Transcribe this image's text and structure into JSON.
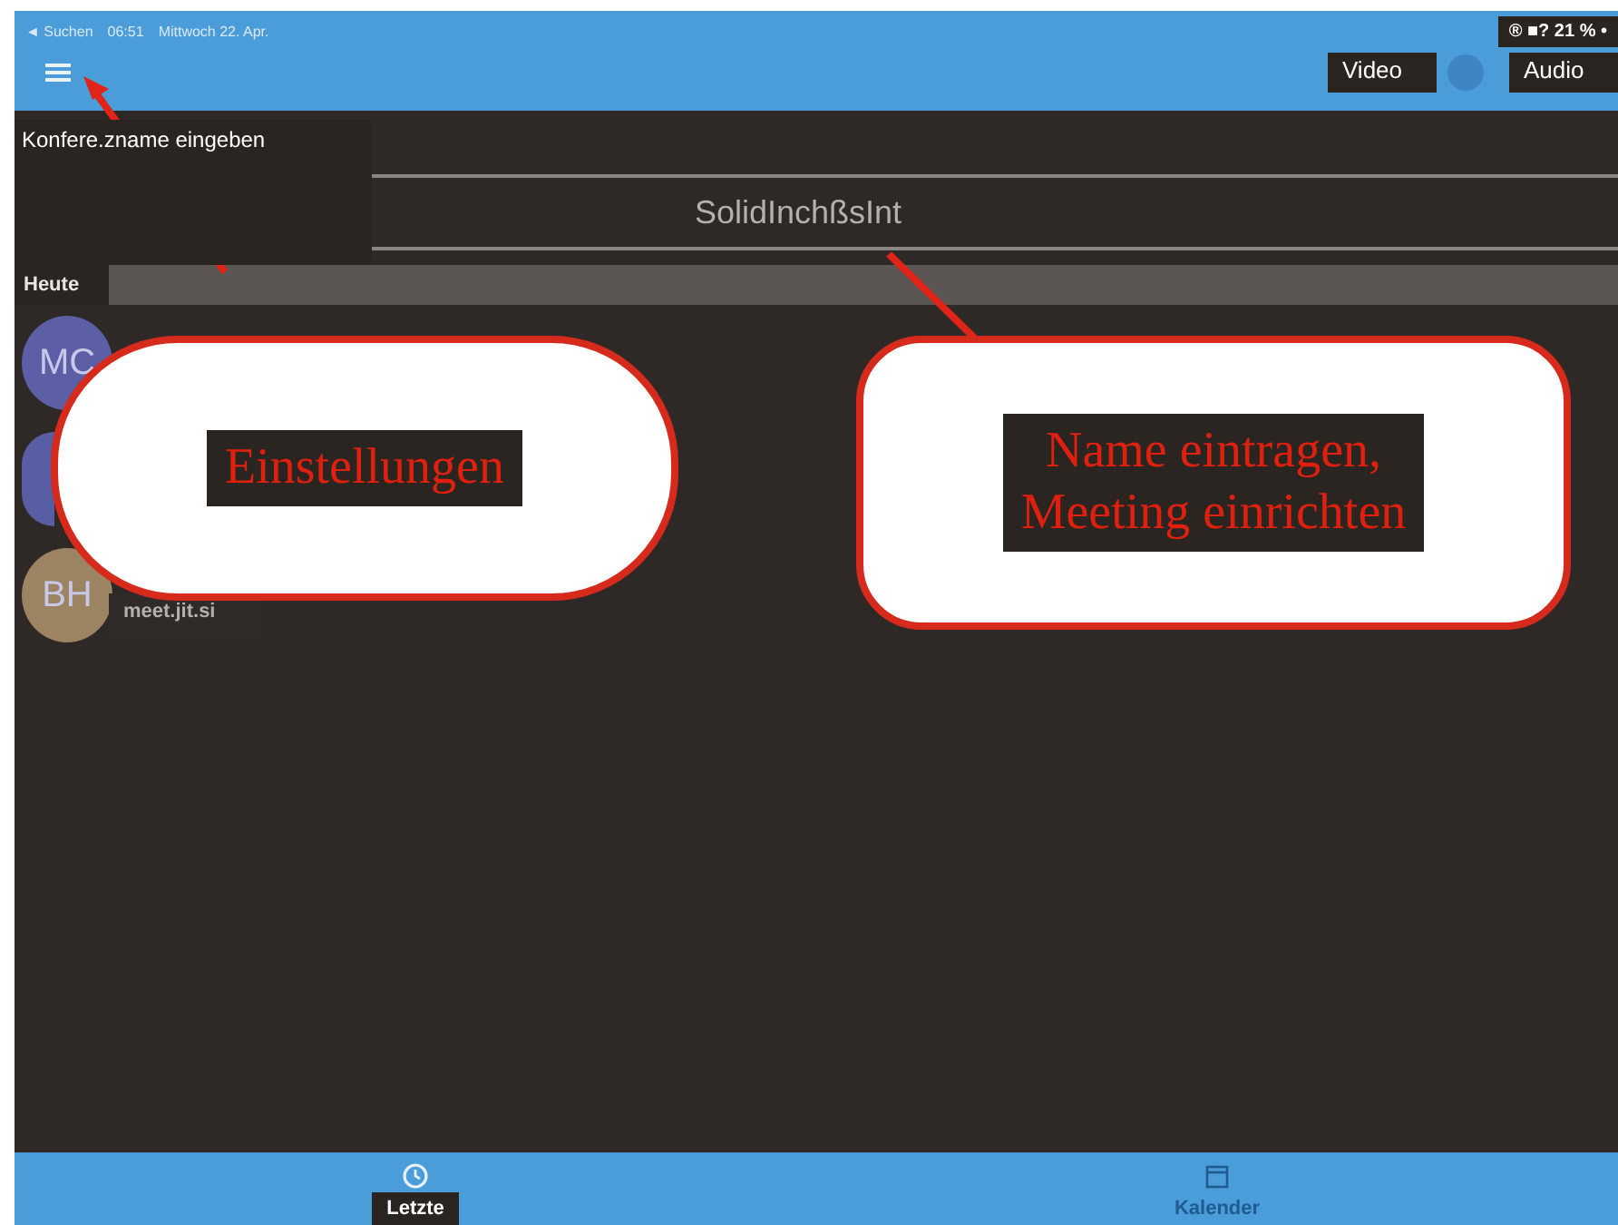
{
  "status_bar": {
    "back": "◄ Suchen",
    "time": "06:51",
    "date": "Mittwoch 22. Apr.",
    "indicators": "® ■? 21 % •"
  },
  "toolbar": {
    "video": "Video",
    "audio": "Audio",
    "toggle_on": true
  },
  "conference": {
    "label": "Konfere.zname eingeben",
    "placeholder": "SolidInchßsInt"
  },
  "section": "Heute",
  "recent": [
    {
      "initials": "MC",
      "color": "#5c5fa6"
    },
    {
      "color": "#585ea4"
    },
    {
      "initials": "BH",
      "color": "#9c8462",
      "subtitle": "meet.jit.si"
    }
  ],
  "tabs": [
    {
      "label": "Letzte",
      "selected": true
    },
    {
      "label": "Kalender",
      "selected": false
    }
  ],
  "callouts": [
    {
      "lines": [
        "Einstellungen"
      ]
    },
    {
      "lines": [
        "Name eintragen,",
        "Meeting einrichten"
      ]
    }
  ]
}
